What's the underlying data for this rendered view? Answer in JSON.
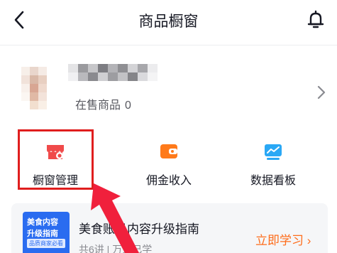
{
  "header": {
    "title": "商品橱窗",
    "back_icon": "chevron-left-icon",
    "notification_icon": "bell-icon"
  },
  "profile": {
    "on_sale_label": "在售商品",
    "on_sale_count": "0",
    "chevron_icon": "chevron-right-icon"
  },
  "tools": [
    {
      "label": "橱窗管理",
      "icon": "shop-settings-icon",
      "color": "#f04a4a"
    },
    {
      "label": "佣金收入",
      "icon": "wallet-icon",
      "color": "#ff7a1a"
    },
    {
      "label": "数据看板",
      "icon": "chart-board-icon",
      "color": "#2aa8f5"
    }
  ],
  "guide": {
    "thumb_line1": "美食内容",
    "thumb_line2": "升级指南",
    "thumb_tag": "品质商家必看",
    "title": "美食账号内容升级指南",
    "subtitle": "共6讲 | 万人已学",
    "cta": "立即学习",
    "cta_color": "#fe6c1a"
  },
  "annotation": {
    "highlight_color": "#e01e1e"
  }
}
